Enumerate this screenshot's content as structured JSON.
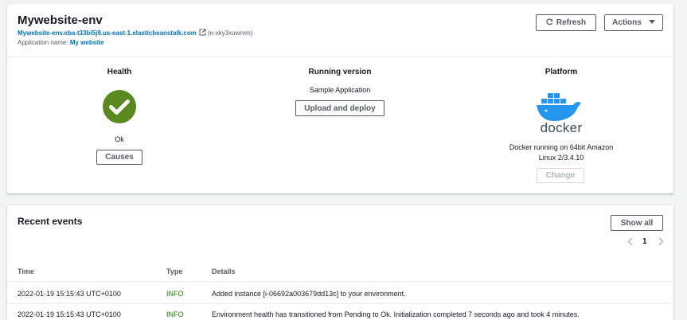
{
  "environment": {
    "name": "Mywebsite-env",
    "url": "Mywebsite-env.eba-t33bi5j9.us-east-1.elasticbeanstalk.com",
    "env_id": "(e-xky3xuwrvm)",
    "app_label": "Application name:",
    "app_name": "My website"
  },
  "buttons": {
    "refresh": "Refresh",
    "actions": "Actions",
    "causes": "Causes",
    "upload_deploy": "Upload and deploy",
    "change": "Change",
    "show_all": "Show all"
  },
  "health": {
    "heading": "Health",
    "status": "Ok",
    "color": "#5a8a1f"
  },
  "running_version": {
    "heading": "Running version",
    "value": "Sample Application"
  },
  "platform": {
    "heading": "Platform",
    "logo_text": "docker",
    "line1": "Docker running on 64bit Amazon",
    "line2": "Linux 2/3.4.10"
  },
  "events": {
    "title": "Recent events",
    "page": "1",
    "columns": [
      "Time",
      "Type",
      "Details"
    ],
    "rows": [
      {
        "time": "2022-01-19 15:15:43 UTC+0100",
        "type": "INFO",
        "details": "Added instance [i-06692a003679dd13c] to your environment."
      },
      {
        "time": "2022-01-19 15:15:43 UTC+0100",
        "type": "INFO",
        "details": "Environment health has transitioned from Pending to Ok. Initialization completed 7 seconds ago and took 4 minutes."
      }
    ]
  }
}
